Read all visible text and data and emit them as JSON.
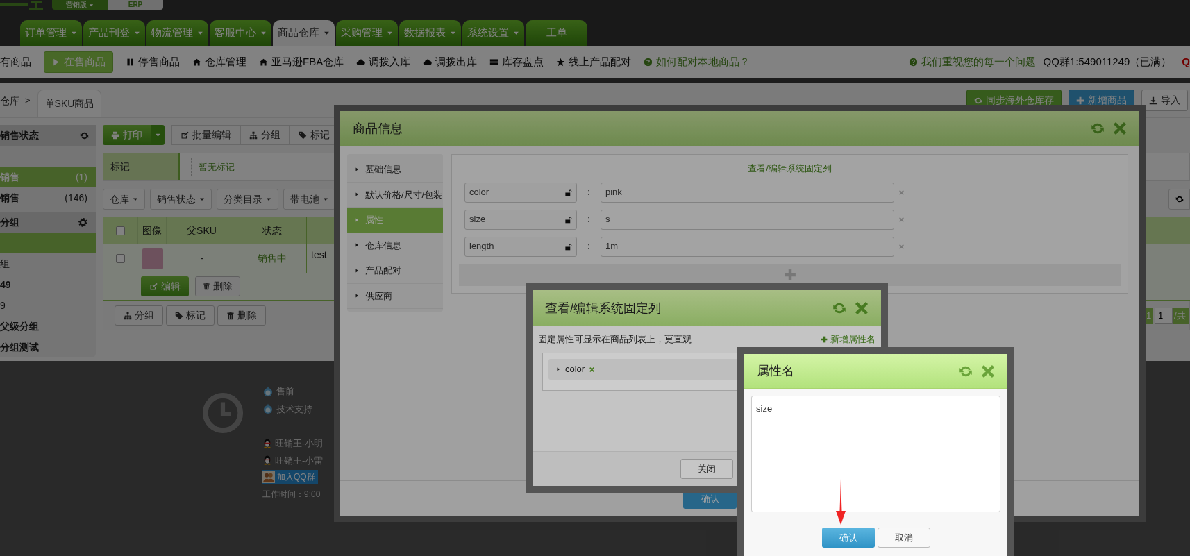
{
  "top_bar": {
    "edition": "营销版",
    "product": "ERP"
  },
  "nav_tabs": [
    {
      "label": "订单管理",
      "has_menu": true,
      "selected": false
    },
    {
      "label": "产品刊登",
      "has_menu": true,
      "selected": false
    },
    {
      "label": "物流管理",
      "has_menu": true,
      "selected": false
    },
    {
      "label": "客服中心",
      "has_menu": true,
      "selected": false
    },
    {
      "label": "商品仓库",
      "has_menu": true,
      "selected": true
    },
    {
      "label": "采购管理",
      "has_menu": true,
      "selected": false
    },
    {
      "label": "数据报表",
      "has_menu": true,
      "selected": false
    },
    {
      "label": "系统设置",
      "has_menu": true,
      "selected": false
    },
    {
      "label": "工单",
      "has_menu": false,
      "selected": false
    }
  ],
  "sub_nav": {
    "items": [
      {
        "label": "有商品",
        "selected": false
      },
      {
        "label": "在售商品",
        "selected": true
      },
      {
        "label": "停售商品",
        "selected": false
      },
      {
        "label": "仓库管理",
        "selected": false
      },
      {
        "label": "亚马逊FBA仓库",
        "selected": false
      },
      {
        "label": "调拨入库",
        "selected": false
      },
      {
        "label": "调拨出库",
        "selected": false
      },
      {
        "label": "库存盘点",
        "selected": false
      },
      {
        "label": "线上产品配对",
        "selected": false
      }
    ],
    "help_link": "如何配对本地商品？",
    "feedback_link": "我们重视您的每一个问题",
    "qq_group": "QQ群1:549011249（已满）",
    "cut_text": "Q"
  },
  "breadcrumb": {
    "parent": "仓库",
    "separator": ">",
    "current": "单SKU商品"
  },
  "page_actions": [
    "同步海外仓库存",
    "新增商品",
    "导入"
  ],
  "sidebar": {
    "status_header": "销售状态",
    "status_items": [
      {
        "label": "销售",
        "count": "(1)",
        "selected": true
      },
      {
        "label": "销售",
        "count": "(146)",
        "selected": false
      }
    ],
    "group_header": "分组",
    "group_items": [
      {
        "selected": true
      },
      {
        "label": "组",
        "kind": "child",
        "selected": false
      },
      {
        "label": "49",
        "kind": "parent",
        "selected": false
      },
      {
        "label": "9",
        "kind": "child",
        "selected": false
      },
      {
        "label": "父级分组",
        "kind": "parent",
        "selected": false
      },
      {
        "label": "分组测试",
        "kind": "parent",
        "selected": false
      }
    ]
  },
  "toolbar": {
    "print": "打印",
    "actions": [
      "批量编辑",
      "分组",
      "标记"
    ]
  },
  "tag_filter": {
    "label": "标记",
    "empty": "暂无标记"
  },
  "filters": [
    "仓库",
    "销售状态",
    "分类目录",
    "带电池"
  ],
  "table": {
    "select_all_checked": false,
    "columns": [
      "图像",
      "父SKU",
      "状态"
    ],
    "rows": [
      {
        "checked": false,
        "parent_sku": "-",
        "status": "销售中",
        "column_5": "test",
        "actions": [
          "编辑",
          "删除"
        ]
      }
    ]
  },
  "bulk_actions": [
    "分组",
    "标记",
    "删除"
  ],
  "pagination": {
    "current": "1",
    "page_input": "1",
    "total_prefix": "/共"
  },
  "footer": {
    "contacts": [
      "售前"
    ],
    "tech_support": "技术支持",
    "qq_contacts": [
      "旺销王-小明",
      "旺销王-小雷"
    ],
    "qq_group_badge": "加入QQ群",
    "hours": "工作时间：9:00"
  },
  "product_dialog": {
    "title": "商品信息",
    "menu": [
      {
        "label": "基础信息",
        "selected": false
      },
      {
        "label": "默认价格/尺寸/包装",
        "selected": false
      },
      {
        "label": "属性",
        "selected": true
      },
      {
        "label": "仓库信息",
        "selected": false
      },
      {
        "label": "产品配对",
        "selected": false
      },
      {
        "label": "供应商",
        "selected": false
      }
    ],
    "panel_title": "查看/编辑系统固定列",
    "attributes": [
      {
        "name": "color",
        "value": "pink"
      },
      {
        "name": "size",
        "value": "s"
      },
      {
        "name": "length",
        "value": "1m"
      }
    ],
    "separator": ":",
    "confirm": "确认"
  },
  "columns_dialog": {
    "title": "查看/编辑系统固定列",
    "hint": "固定属性可显示在商品列表上，更直观",
    "add_link": "新增属性名",
    "columns": [
      {
        "name": "color"
      }
    ],
    "close": "关闭"
  },
  "name_dialog": {
    "title": "属性名",
    "value": "size",
    "confirm": "确认",
    "cancel": "取消"
  }
}
